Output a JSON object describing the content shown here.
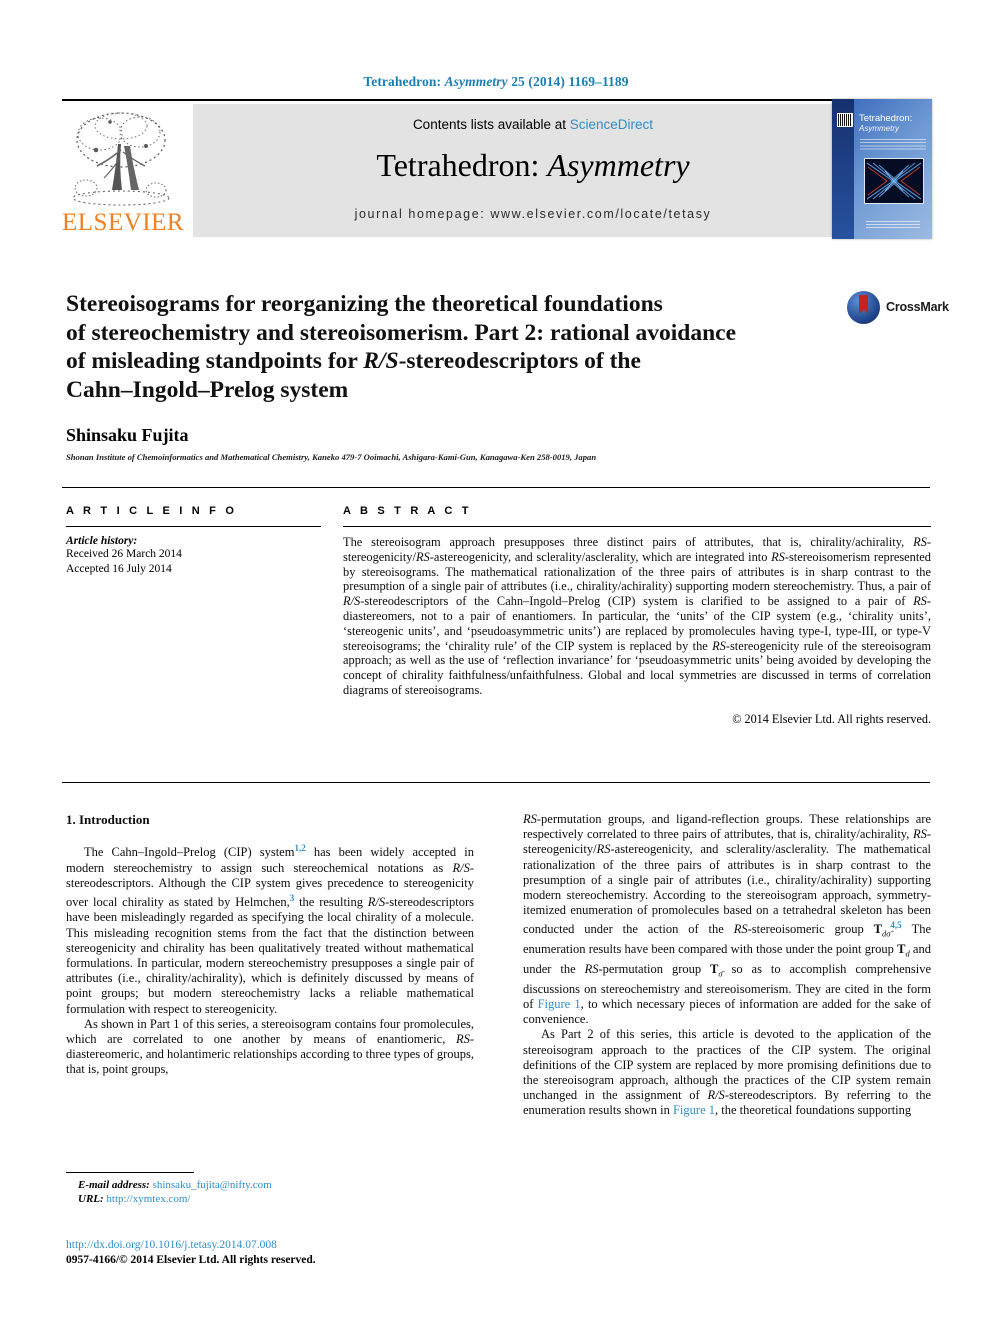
{
  "running_head": {
    "journal": "Tetrahedron:",
    "journal_italic": "Asymmetry",
    "citation": "25 (2014) 1169–1189"
  },
  "masthead": {
    "publisher": "ELSEVIER",
    "contents_prefix": "Contents lists available at ",
    "contents_link": "ScienceDirect",
    "journal_title_main": "Tetrahedron: ",
    "journal_title_italic": "Asymmetry",
    "homepage": "journal homepage: www.elsevier.com/locate/tetasy"
  },
  "cover": {
    "title_line1": "Tetrahedron:",
    "title_line2": "Asymmetry"
  },
  "article": {
    "title_line1": "Stereoisograms for reorganizing the theoretical foundations",
    "title_line2": "of stereochemistry and stereoisomerism. Part 2: rational avoidance",
    "title_line3_a": "of misleading standpoints for ",
    "title_line3_ital": "R/S",
    "title_line3_b": "-stereodescriptors of the",
    "title_line4": "Cahn–Ingold–Prelog system",
    "author": "Shinsaku Fujita",
    "affiliation": "Shonan Institute of Chemoinformatics and Mathematical Chemistry, Kaneko 479-7 Ooimachi, Ashigara-Kami-Gun, Kanagawa-Ken 258-0019, Japan",
    "crossmark_label": "CrossMark"
  },
  "article_info": {
    "heading": "A R T I C L E   I N F O",
    "history_label": "Article history:",
    "received": "Received 26 March 2014",
    "accepted": "Accepted 16 July 2014"
  },
  "abstract": {
    "heading": "A B S T R A C T",
    "p1_a": "The stereoisogram approach presupposes three distinct pairs of attributes, that is, chirality/achirality, ",
    "p1_i1": "RS",
    "p1_b": "-stereogenicity/",
    "p1_i2": "RS",
    "p1_c": "-astereogenicity, and sclerality/asclerality, which are integrated into ",
    "p1_i3": "RS",
    "p1_d": "-stereoisomerism represented by stereoisograms. The mathematical rationalization of the three pairs of attributes is in sharp contrast to the presumption of a single pair of attributes (i.e., chirality/achirality) supporting modern stereochemistry. Thus, a pair of ",
    "p1_i4": "R/S",
    "p1_e": "-stereodescriptors of the Cahn–Ingold–Prelog (CIP) system is clarified to be assigned to a pair of ",
    "p1_i5": "RS",
    "p1_f": "-diastereomers, not to a pair of enantiomers. In particular, the ‘units’ of the CIP system (e.g., ‘chirality units’, ‘stereogenic units’, and ‘pseudoasymmetric units’) are replaced by promolecules having type-I, type-III, or type-V stereoisograms; the ‘chirality rule’ of the CIP system is replaced by the ",
    "p1_i6": "RS",
    "p1_g": "-stereogenicity rule of the stereoisogram approach; as well as the use of ‘reflection invariance’ for ‘pseudoasymmetric units’ being avoided by developing the concept of chirality faithfulness/unfaithfulness. Global and local symmetries are discussed in terms of correlation diagrams of stereoisograms.",
    "copyright": "© 2014 Elsevier Ltd. All rights reserved."
  },
  "body": {
    "section_heading": "1. Introduction",
    "left_p1_a": "The Cahn–Ingold–Prelog (CIP) system",
    "left_p1_ref1": "1,2",
    "left_p1_b": " has been widely accepted in modern stereochemistry to assign such stereochemical notations as ",
    "left_p1_i1": "R/S",
    "left_p1_c": "-stereodescriptors. Although the CIP system gives precedence to stereogenicity over local chirality as stated by Helmchen,",
    "left_p1_ref2": "3",
    "left_p1_d": " the resulting ",
    "left_p1_i2": "R/S",
    "left_p1_e": "-stereodescriptors have been misleadingly regarded as specifying the local chirality of a molecule. This misleading recognition stems from the fact that the distinction between stereogenicity and chirality has been qualitatively treated without mathematical formulations. In particular, modern stereochemistry presupposes a single pair of attributes (i.e., chirality/achirality), which is definitely discussed by means of point groups; but modern stereochemistry lacks a reliable mathematical formulation with respect to stereogenicity.",
    "left_p2_a": "As shown in Part 1 of this series, a stereoisogram contains four promolecules, which are correlated to one another by means of enantiomeric, ",
    "left_p2_i1": "RS",
    "left_p2_b": "-diastereomeric, and holantimeric relationships according to three types of groups, that is, point groups,",
    "right_p1_i1": "RS",
    "right_p1_a": "-permutation groups, and ligand-reflection groups. These relationships are respectively correlated to three pairs of attributes, that is, chirality/achirality, ",
    "right_p1_i2": "RS",
    "right_p1_b": "-stereogenicity/",
    "right_p1_i3": "RS",
    "right_p1_c": "-astereogenicity, and sclerality/asclerality. The mathematical rationalization of the three pairs of attributes is in sharp contrast to the presumption of a single pair of attributes (i.e., chirality/achirality) supporting modern stereochemistry. According to the stereoisogram approach, symmetry-itemized enumeration of promolecules based on a tetrahedral skeleton has been conducted under the action of the ",
    "right_p1_i4": "RS",
    "right_p1_d": "-stereoisomeric group ",
    "right_p1_grp1": "T",
    "right_p1_grp1_sub": "dσ̂",
    "right_p1_ref1": "4,5",
    "right_p1_e": " The enumeration results have been compared with those under the point group ",
    "right_p1_grp2": "T",
    "right_p1_grp2_sub": "d",
    "right_p1_f": " and under the ",
    "right_p1_i5": "RS",
    "right_p1_g": "-permutation group ",
    "right_p1_grp3": "T",
    "right_p1_grp3_sub": "σ̄",
    "right_p1_h": " so as to accomplish comprehensive discussions on stereochemistry and stereoisomerism. They are cited in the form of ",
    "right_p1_link": "Figure 1",
    "right_p1_i": ", to which necessary pieces of information are added for the sake of convenience.",
    "right_p2_a": "As Part 2 of this series, this article is devoted to the application of the stereoisogram approach to the practices of the CIP system. The original definitions of the CIP system are replaced by more promising definitions due to the stereoisogram approach, although the practices of the CIP system remain unchanged in the assignment of ",
    "right_p2_i1": "R/S",
    "right_p2_b": "-stereodescriptors. By referring to the enumeration results shown in ",
    "right_p2_link": "Figure 1",
    "right_p2_c": ", the theoretical foundations supporting"
  },
  "footer": {
    "email_label": "E-mail address:",
    "email": "shinsaku_fujita@nifty.com",
    "url_label": "URL:",
    "url": "http://xymtex.com/",
    "doi": "http://dx.doi.org/10.1016/j.tetasy.2014.07.008",
    "issn_line": "0957-4166/© 2014 Elsevier Ltd. All rights reserved."
  },
  "colors": {
    "link_blue": "#2E8FC7",
    "running_head_blue": "#1a7fb5",
    "elsevier_orange": "#f08020",
    "band_gray": "#e3e3e3"
  }
}
